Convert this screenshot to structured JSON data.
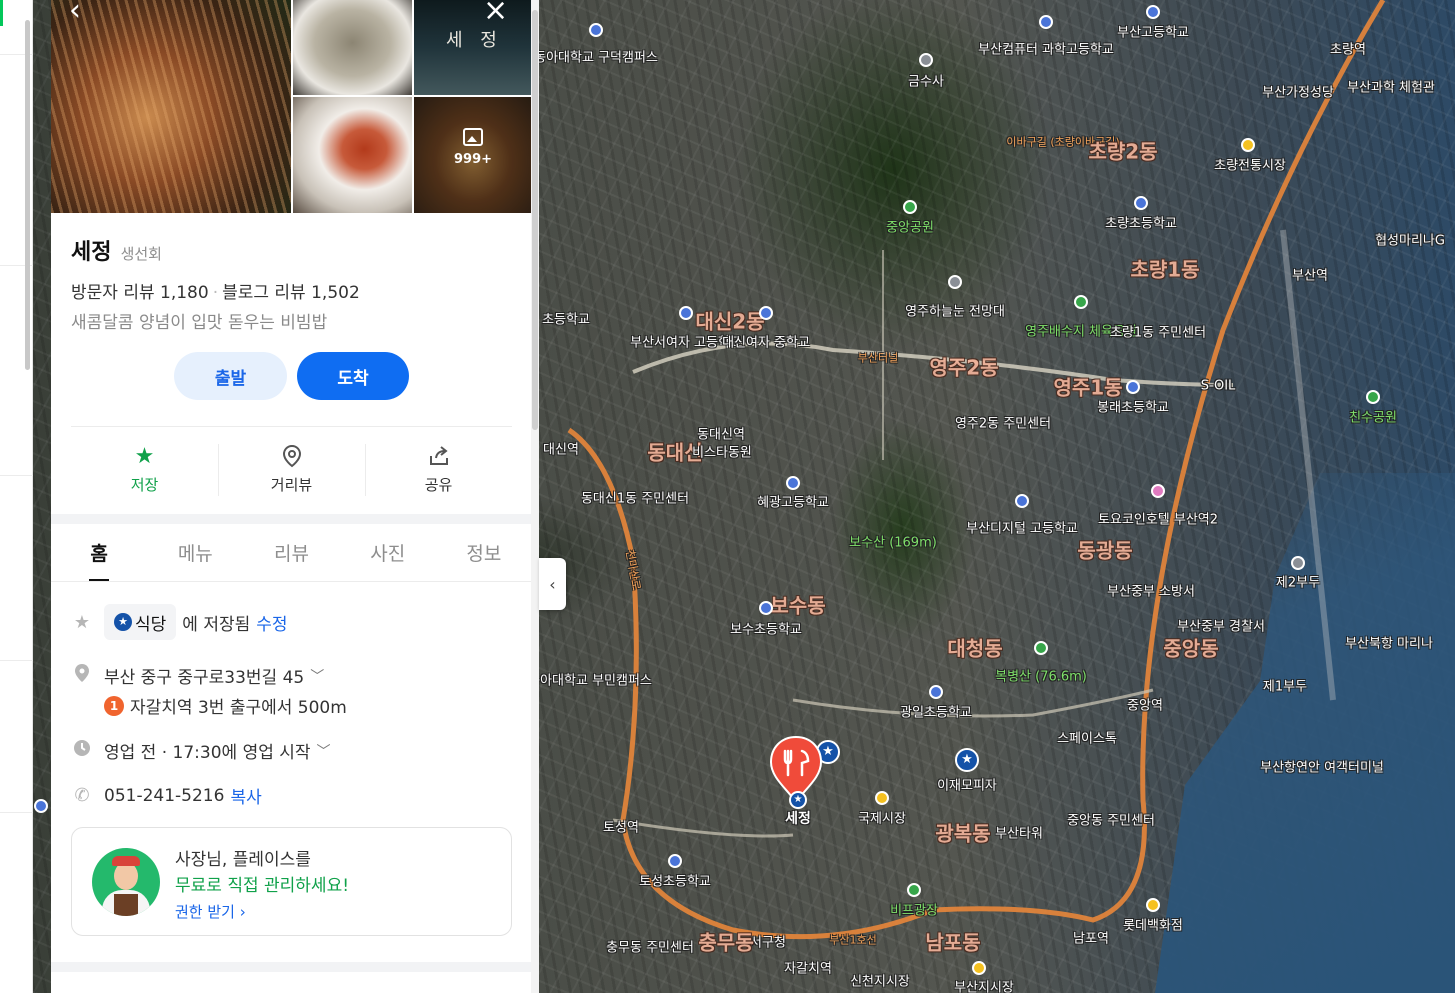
{
  "place": {
    "name": "세정",
    "category": "생선회",
    "visitor_reviews": "방문자 리뷰 1,180",
    "blog_reviews": "블로그 리뷰 1,502",
    "tagline": "새콤달콤 양념이 입맛 돋우는 비빔밥",
    "photo_count": "999+"
  },
  "buttons": {
    "depart": "출발",
    "arrive": "도착"
  },
  "actions": [
    {
      "label": "저장",
      "icon": "star-icon"
    },
    {
      "label": "거리뷰",
      "icon": "location-pin-icon"
    },
    {
      "label": "공유",
      "icon": "share-icon"
    }
  ],
  "tabs": [
    "홈",
    "메뉴",
    "리뷰",
    "사진",
    "정보"
  ],
  "active_tab": "홈",
  "info": {
    "saved_folder": "식당",
    "saved_suffix": "에 저장됨",
    "edit": "수정",
    "address": "부산 중구 중구로33번길 45",
    "subway_line": "1",
    "subway_directions": "자갈치역 3번 출구에서 500m",
    "hours": "영업 전 · 17:30에 영업 시작",
    "phone": "051-241-5216",
    "copy": "복사"
  },
  "promo": {
    "line1": "사장님, 플레이스를",
    "line2": "무료로 직접 관리하세요!",
    "line3": "권한 받기"
  },
  "map": {
    "marker_label": "세정",
    "labels": [
      "동아대학교 구덕캠퍼스",
      "부산컴퓨터 과학고등학교",
      "부산고등학교",
      "초량역",
      "부산과학 체험관",
      "금수사",
      "부산가정성당",
      "이바구길 (초량이바구길)",
      "초량2동",
      "초량전통시장",
      "중앙공원",
      "초량초등학교",
      "협성마리나G",
      "부산역",
      "초량1동",
      "영주하늘눈 전망대",
      "초등학교",
      "부산서여자 고등학교",
      "대신여자 중학교",
      "대신2동",
      "영주배수지 체육공원",
      "초량1동 주민센터",
      "부산터널",
      "영주2동",
      "영주1동",
      "봉래초등학교",
      "S-OIL",
      "친수공원",
      "동대신역",
      "동대신",
      "비스타동원",
      "대신역",
      "영주2동 주민센터",
      "동대신1동 주민센터",
      "혜광고등학교",
      "보수산 (169m)",
      "부산디지털 고등학교",
      "토요코인호텔 부산역2",
      "동광동",
      "부산중부 소방서",
      "제2부두",
      "부산중부 경찰서",
      "부산북항 마리나",
      "보수동",
      "보수초등학교",
      "대청동",
      "중앙동",
      "동아대학교 부민캠퍼스",
      "복병산 (76.6m)",
      "중앙역",
      "제1부두",
      "광일초등학교",
      "스페이스톡",
      "이재모피자",
      "부산항연안 여객터미널",
      "국제시장",
      "토성역",
      "광복동",
      "부산타워",
      "중앙동 주민센터",
      "토성초등학교",
      "비프광장",
      "충무동 주민센터",
      "서구청",
      "부산1호선",
      "롯데백화점",
      "남포역",
      "남포동",
      "자갈치역",
      "신천지시장",
      "부산지시장",
      "충무동",
      "천마산로"
    ]
  },
  "colors": {
    "accent_blue": "#0f6df2",
    "save_green": "#10a14a",
    "marker_red": "#f04b3a",
    "road_orange": "#e8863a"
  }
}
